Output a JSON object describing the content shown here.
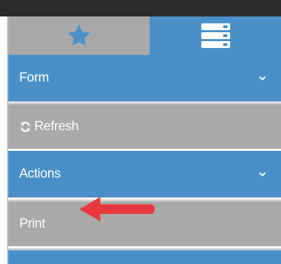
{
  "tabs": {
    "favorites_icon": "star-icon",
    "menu_icon": "server-list-icon"
  },
  "menu": {
    "form": {
      "label": "Form",
      "icon": "chevron-down-icon"
    },
    "refresh": {
      "label": "Refresh",
      "icon": "refresh-icon"
    },
    "actions": {
      "label": "Actions",
      "icon": "chevron-down-icon"
    },
    "print": {
      "label": "Print"
    }
  },
  "annotation": {
    "arrow_color": "#e8383d",
    "points_to": "print"
  },
  "colors": {
    "accent": "#4a90c8",
    "item_bg": "#a9a9a9",
    "tab_inactive": "#a8a8a8",
    "topbar": "#2b2b2b"
  }
}
